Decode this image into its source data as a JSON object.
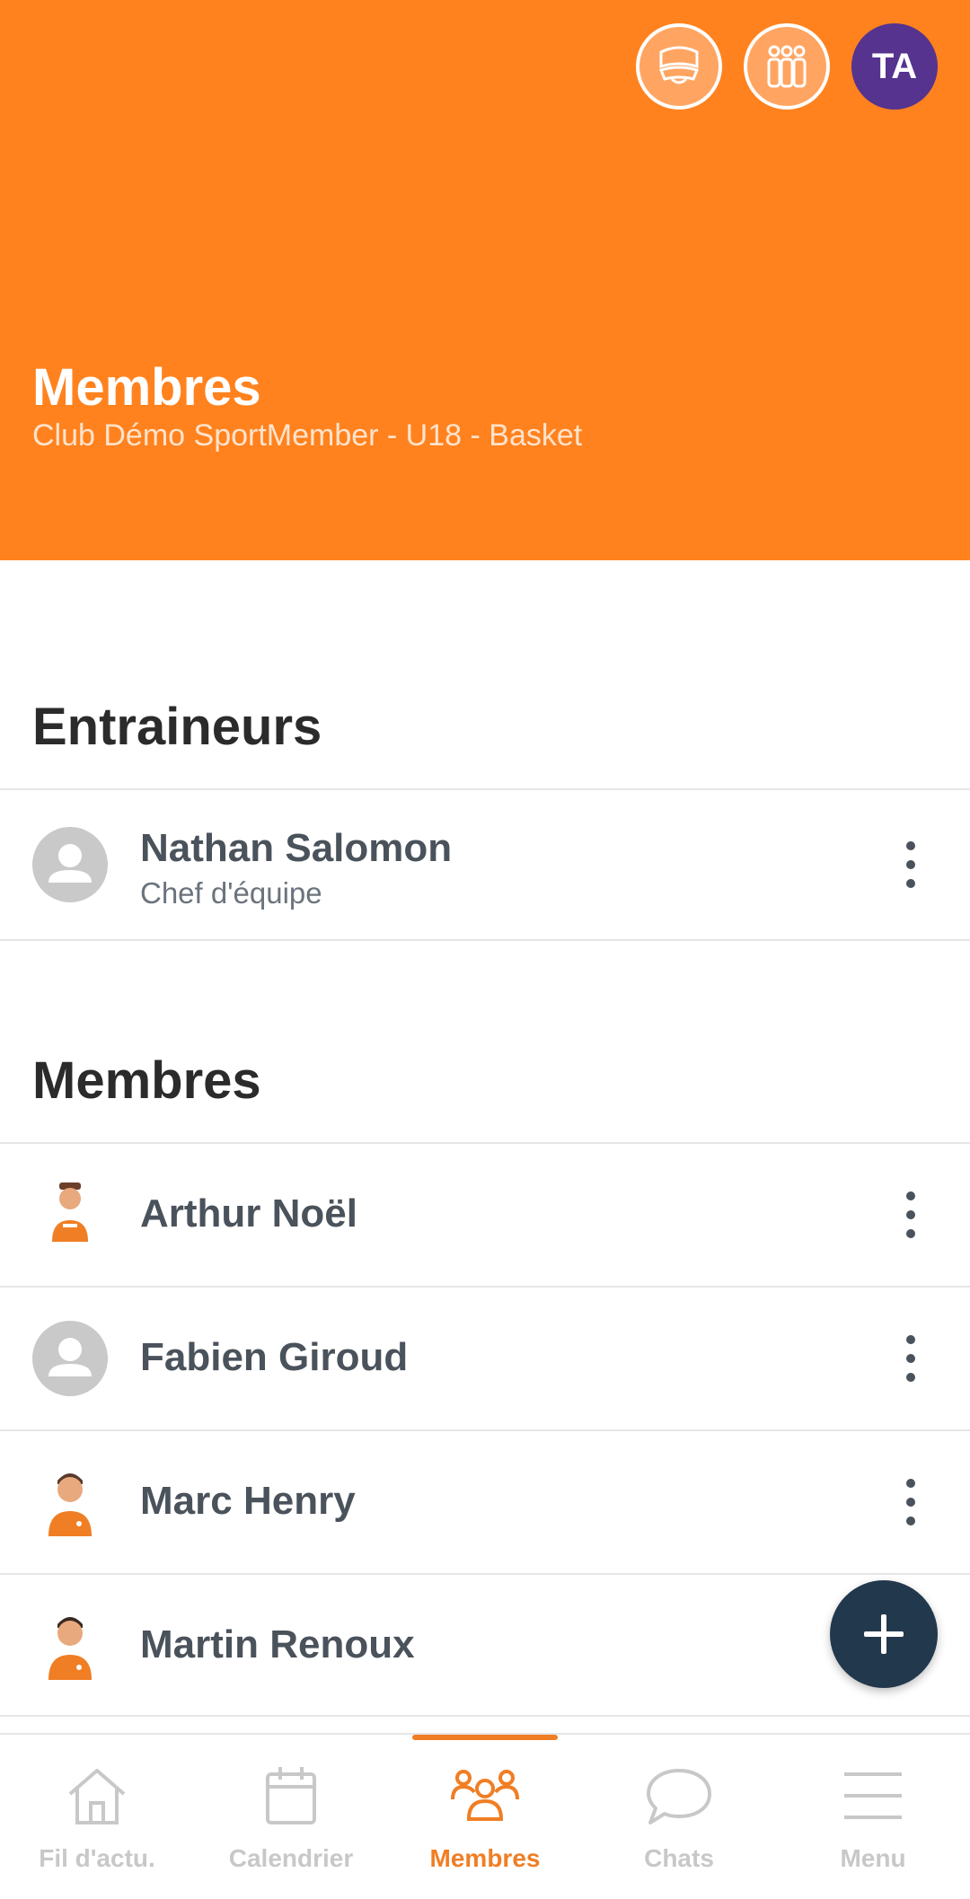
{
  "header": {
    "title": "Membres",
    "subtitle": "Club Démo SportMember - U18 - Basket",
    "avatar_initials": "TA",
    "icons": [
      "team-badge-icon",
      "team-group-icon"
    ]
  },
  "coaches_section": {
    "title": "Entraineurs",
    "items": [
      {
        "name": "Nathan Salomon",
        "role": "Chef d'équipe",
        "avatar": "default-avatar-icon"
      }
    ]
  },
  "members_section": {
    "title": "Membres",
    "items": [
      {
        "name": "Arthur Noël",
        "avatar": "player-avatar"
      },
      {
        "name": "Fabien Giroud",
        "avatar": "default-avatar-icon"
      },
      {
        "name": "Marc Henry",
        "avatar": "player-avatar"
      },
      {
        "name": "Martin Renoux",
        "avatar": "player-avatar"
      }
    ]
  },
  "nav": {
    "items": [
      {
        "label": "Fil d'actu.",
        "icon": "home-icon",
        "active": false
      },
      {
        "label": "Calendrier",
        "icon": "calendar-icon",
        "active": false
      },
      {
        "label": "Membres",
        "icon": "members-icon",
        "active": true
      },
      {
        "label": "Chats",
        "icon": "chat-icon",
        "active": false
      },
      {
        "label": "Menu",
        "icon": "menu-icon",
        "active": false
      }
    ]
  },
  "colors": {
    "header": "#FF821E",
    "accent": "#F07E24",
    "fab": "#22384D",
    "avatar": "#55338F"
  }
}
